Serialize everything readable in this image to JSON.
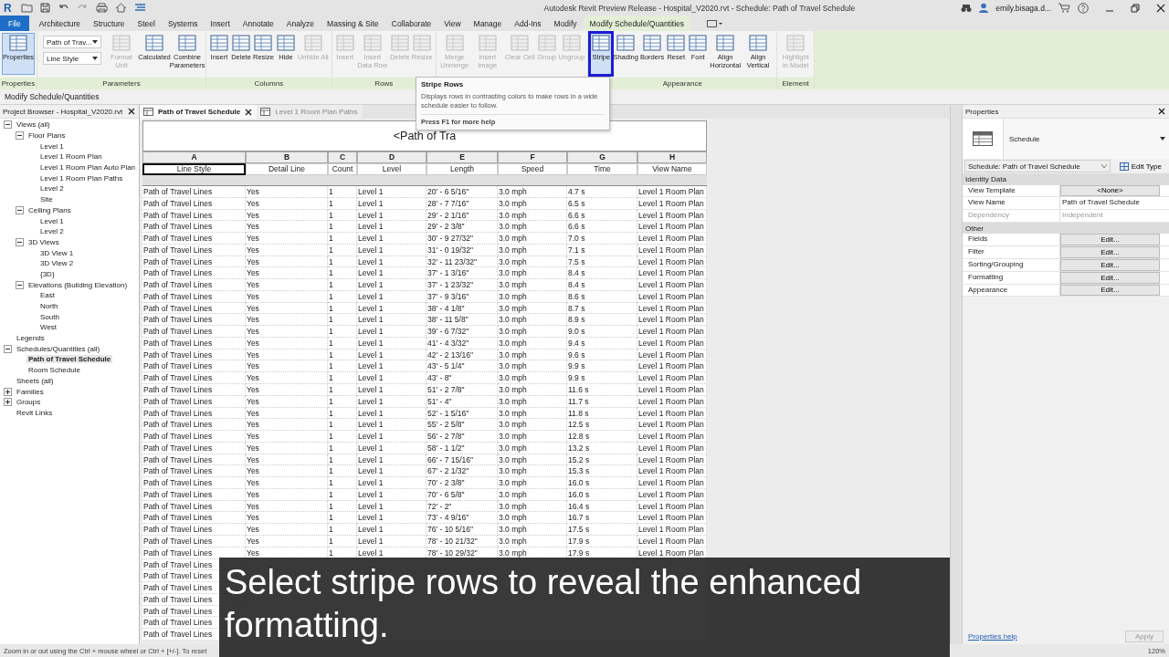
{
  "window": {
    "app_logo": "R",
    "title": "Autodesk Revit Preview Release - Hospital_V2020.rvt - Schedule: Path of Travel Schedule",
    "user": "emily.bisaga.d..."
  },
  "tabs": [
    {
      "label": "File",
      "kind": "file",
      "selected": false
    },
    {
      "label": "Architecture",
      "kind": "tab",
      "selected": false
    },
    {
      "label": "Structure",
      "kind": "tab",
      "selected": false
    },
    {
      "label": "Steel",
      "kind": "tab",
      "selected": false
    },
    {
      "label": "Systems",
      "kind": "tab",
      "selected": false
    },
    {
      "label": "Insert",
      "kind": "tab",
      "selected": false
    },
    {
      "label": "Annotate",
      "kind": "tab",
      "selected": false
    },
    {
      "label": "Analyze",
      "kind": "tab",
      "selected": false
    },
    {
      "label": "Massing & Site",
      "kind": "tab",
      "selected": false
    },
    {
      "label": "Collaborate",
      "kind": "tab",
      "selected": false
    },
    {
      "label": "View",
      "kind": "tab",
      "selected": false
    },
    {
      "label": "Manage",
      "kind": "tab",
      "selected": false
    },
    {
      "label": "Add-Ins",
      "kind": "tab",
      "selected": false
    },
    {
      "label": "Modify",
      "kind": "tab",
      "selected": false
    },
    {
      "label": "Modify Schedule/Quantities",
      "kind": "contextual",
      "selected": true
    }
  ],
  "ribbon": {
    "groups": [
      {
        "label": "Properties",
        "items": [
          {
            "kind": "large",
            "label": "Properties",
            "disabled": false,
            "selected": true
          }
        ]
      },
      {
        "label": "Parameters",
        "items": [
          {
            "kind": "dropdowns",
            "values": [
              "Path of Trav...",
              "Line Style"
            ]
          },
          {
            "kind": "large",
            "label": "Format Unit",
            "disabled": true,
            "selected": false
          },
          {
            "kind": "large",
            "label": "Calculated",
            "disabled": false,
            "selected": false
          },
          {
            "kind": "large",
            "label": "Combine Parameters",
            "disabled": false,
            "selected": false
          }
        ]
      },
      {
        "label": "Columns",
        "items": [
          {
            "kind": "large",
            "label": "Insert",
            "disabled": false,
            "selected": false
          },
          {
            "kind": "large",
            "label": "Delete",
            "disabled": false,
            "selected": false
          },
          {
            "kind": "large",
            "label": "Resize",
            "disabled": false,
            "selected": false
          },
          {
            "kind": "large",
            "label": "Hide",
            "disabled": false,
            "selected": false
          },
          {
            "kind": "large",
            "label": "Unhide All",
            "disabled": true,
            "selected": false
          }
        ]
      },
      {
        "label": "Rows",
        "items": [
          {
            "kind": "large",
            "label": "Insert",
            "disabled": true,
            "selected": false
          },
          {
            "kind": "large",
            "label": "Insert Data Row",
            "disabled": true,
            "selected": false
          },
          {
            "kind": "large",
            "label": "Delete",
            "disabled": true,
            "selected": false
          },
          {
            "kind": "large",
            "label": "Resize",
            "disabled": true,
            "selected": false
          }
        ]
      },
      {
        "items": [
          {
            "kind": "large",
            "label": "Merge Unmerge",
            "disabled": true,
            "selected": false
          },
          {
            "kind": "large",
            "label": "Insert Image",
            "disabled": true,
            "selected": false
          },
          {
            "kind": "large",
            "label": "Clear Cell",
            "disabled": true,
            "selected": false
          },
          {
            "kind": "large",
            "label": "Group",
            "disabled": true,
            "selected": false
          },
          {
            "kind": "large",
            "label": "Ungroup",
            "disabled": true,
            "selected": false
          }
        ]
      },
      {
        "label": "Appearance",
        "items": [
          {
            "kind": "large",
            "label": "Stripe",
            "disabled": false,
            "selected": true,
            "highlighted": true
          },
          {
            "kind": "large",
            "label": "Shading",
            "disabled": false,
            "selected": false
          },
          {
            "kind": "large",
            "label": "Borders",
            "disabled": false,
            "selected": false
          },
          {
            "kind": "large",
            "label": "Reset",
            "disabled": false,
            "selected": false
          },
          {
            "kind": "large",
            "label": "Font",
            "disabled": false,
            "selected": false
          },
          {
            "kind": "large",
            "label": "Align Horizontal",
            "disabled": false,
            "selected": false
          },
          {
            "kind": "large",
            "label": "Align Vertical",
            "disabled": false,
            "selected": false
          }
        ]
      },
      {
        "label": "Element",
        "items": [
          {
            "kind": "large",
            "label": "Highlight in Model",
            "disabled": true,
            "selected": false
          }
        ]
      }
    ]
  },
  "tooltip": {
    "title": "Stripe Rows",
    "text": "Displays rows in contrasting colors to make rows in a wide schedule easier to follow.",
    "help": "Press F1 for more help"
  },
  "options_bar": "Modify Schedule/Quantities",
  "project_browser": {
    "title": "Project Browser - Hospital_V2020.rvt",
    "tree": [
      {
        "label": "Views (all)",
        "expanded": true,
        "selected": false,
        "children": [
          {
            "label": "Floor Plans",
            "expanded": true,
            "selected": false,
            "children": [
              {
                "label": "Level 1",
                "selected": false
              },
              {
                "label": "Level 1 Room Plan",
                "selected": false
              },
              {
                "label": "Level 1 Room Plan Auto Plan",
                "selected": false
              },
              {
                "label": "Level 1 Room Plan Paths",
                "selected": false
              },
              {
                "label": "Level 2",
                "selected": false
              },
              {
                "label": "Site",
                "selected": false
              }
            ]
          },
          {
            "label": "Ceiling Plans",
            "expanded": true,
            "selected": false,
            "children": [
              {
                "label": "Level 1",
                "selected": false
              },
              {
                "label": "Level 2",
                "selected": false
              }
            ]
          },
          {
            "label": "3D Views",
            "expanded": true,
            "selected": false,
            "children": [
              {
                "label": "3D View 1",
                "selected": false
              },
              {
                "label": "3D View 2",
                "selected": false
              },
              {
                "label": "{3D}",
                "selected": false
              }
            ]
          },
          {
            "label": "Elevations (Building Elevation)",
            "expanded": true,
            "selected": false,
            "children": [
              {
                "label": "East",
                "selected": false
              },
              {
                "label": "North",
                "selected": false
              },
              {
                "label": "South",
                "selected": false
              },
              {
                "label": "West",
                "selected": false
              }
            ]
          }
        ]
      },
      {
        "label": "Legends",
        "selected": false
      },
      {
        "label": "Schedules/Quantities (all)",
        "expanded": true,
        "selected": false,
        "children": [
          {
            "label": "Path of Travel Schedule",
            "selected": true
          },
          {
            "label": "Room Schedule",
            "selected": false
          }
        ]
      },
      {
        "label": "Sheets (all)",
        "selected": false
      },
      {
        "label": "Families",
        "expanded": false,
        "selected": false
      },
      {
        "label": "Groups",
        "expanded": false,
        "selected": false
      },
      {
        "label": "Revit Links",
        "selected": false
      }
    ]
  },
  "view_tabs": [
    {
      "label": "Path of Travel Schedule",
      "selected": true
    },
    {
      "label": "Level 1 Room Plan Paths",
      "selected": false
    }
  ],
  "schedule": {
    "title": "<Path of Tra",
    "columns": [
      {
        "letter": "A",
        "name": "Line Style",
        "selected": true
      },
      {
        "letter": "B",
        "name": "Detail Line",
        "selected": false
      },
      {
        "letter": "C",
        "name": "Count",
        "selected": false
      },
      {
        "letter": "D",
        "name": "Level",
        "selected": false
      },
      {
        "letter": "E",
        "name": "Length",
        "selected": false
      },
      {
        "letter": "F",
        "name": "Speed",
        "selected": false
      },
      {
        "letter": "G",
        "name": "Time",
        "selected": false
      },
      {
        "letter": "H",
        "name": "View Name",
        "selected": false
      }
    ],
    "rows": [
      [
        "Path of Travel Lines",
        "Yes",
        "1",
        "Level 1",
        "20' - 6 5/16\"",
        "3.0 mph",
        "4.7 s",
        "Level 1 Room Plan"
      ],
      [
        "Path of Travel Lines",
        "Yes",
        "1",
        "Level 1",
        "28' - 7 7/16\"",
        "3.0 mph",
        "6.5 s",
        "Level 1 Room Plan"
      ],
      [
        "Path of Travel Lines",
        "Yes",
        "1",
        "Level 1",
        "29' - 2 1/16\"",
        "3.0 mph",
        "6.6 s",
        "Level 1 Room Plan"
      ],
      [
        "Path of Travel Lines",
        "Yes",
        "1",
        "Level 1",
        "29' - 2 3/8\"",
        "3.0 mph",
        "6.6 s",
        "Level 1 Room Plan"
      ],
      [
        "Path of Travel Lines",
        "Yes",
        "1",
        "Level 1",
        "30' - 9 27/32\"",
        "3.0 mph",
        "7.0 s",
        "Level 1 Room Plan"
      ],
      [
        "Path of Travel Lines",
        "Yes",
        "1",
        "Level 1",
        "31' - 0 19/32\"",
        "3.0 mph",
        "7.1 s",
        "Level 1 Room Plan"
      ],
      [
        "Path of Travel Lines",
        "Yes",
        "1",
        "Level 1",
        "32' - 11 23/32\"",
        "3.0 mph",
        "7.5 s",
        "Level 1 Room Plan"
      ],
      [
        "Path of Travel Lines",
        "Yes",
        "1",
        "Level 1",
        "37' - 1 3/16\"",
        "3.0 mph",
        "8.4 s",
        "Level 1 Room Plan"
      ],
      [
        "Path of Travel Lines",
        "Yes",
        "1",
        "Level 1",
        "37' - 1 23/32\"",
        "3.0 mph",
        "8.4 s",
        "Level 1 Room Plan"
      ],
      [
        "Path of Travel Lines",
        "Yes",
        "1",
        "Level 1",
        "37' - 9 3/16\"",
        "3.0 mph",
        "8.6 s",
        "Level 1 Room Plan"
      ],
      [
        "Path of Travel Lines",
        "Yes",
        "1",
        "Level 1",
        "38' - 4 1/8\"",
        "3.0 mph",
        "8.7 s",
        "Level 1 Room Plan"
      ],
      [
        "Path of Travel Lines",
        "Yes",
        "1",
        "Level 1",
        "38' - 11 5/8\"",
        "3.0 mph",
        "8.9 s",
        "Level 1 Room Plan"
      ],
      [
        "Path of Travel Lines",
        "Yes",
        "1",
        "Level 1",
        "39' - 6 7/32\"",
        "3.0 mph",
        "9.0 s",
        "Level 1 Room Plan"
      ],
      [
        "Path of Travel Lines",
        "Yes",
        "1",
        "Level 1",
        "41' - 4 3/32\"",
        "3.0 mph",
        "9.4 s",
        "Level 1 Room Plan"
      ],
      [
        "Path of Travel Lines",
        "Yes",
        "1",
        "Level 1",
        "42' - 2 13/16\"",
        "3.0 mph",
        "9.6 s",
        "Level 1 Room Plan"
      ],
      [
        "Path of Travel Lines",
        "Yes",
        "1",
        "Level 1",
        "43' - 5 1/4\"",
        "3.0 mph",
        "9.9 s",
        "Level 1 Room Plan"
      ],
      [
        "Path of Travel Lines",
        "Yes",
        "1",
        "Level 1",
        "43' - 8\"",
        "3.0 mph",
        "9.9 s",
        "Level 1 Room Plan"
      ],
      [
        "Path of Travel Lines",
        "Yes",
        "1",
        "Level 1",
        "51' - 2 7/8\"",
        "3.0 mph",
        "11.6 s",
        "Level 1 Room Plan"
      ],
      [
        "Path of Travel Lines",
        "Yes",
        "1",
        "Level 1",
        "51' - 4\"",
        "3.0 mph",
        "11.7 s",
        "Level 1 Room Plan"
      ],
      [
        "Path of Travel Lines",
        "Yes",
        "1",
        "Level 1",
        "52' - 1 5/16\"",
        "3.0 mph",
        "11.8 s",
        "Level 1 Room Plan"
      ],
      [
        "Path of Travel Lines",
        "Yes",
        "1",
        "Level 1",
        "55' - 2 5/8\"",
        "3.0 mph",
        "12.5 s",
        "Level 1 Room Plan"
      ],
      [
        "Path of Travel Lines",
        "Yes",
        "1",
        "Level 1",
        "56' - 2 7/8\"",
        "3.0 mph",
        "12.8 s",
        "Level 1 Room Plan"
      ],
      [
        "Path of Travel Lines",
        "Yes",
        "1",
        "Level 1",
        "58' - 1 1/2\"",
        "3.0 mph",
        "13.2 s",
        "Level 1 Room Plan"
      ],
      [
        "Path of Travel Lines",
        "Yes",
        "1",
        "Level 1",
        "66' - 7 15/16\"",
        "3.0 mph",
        "15.2 s",
        "Level 1 Room Plan"
      ],
      [
        "Path of Travel Lines",
        "Yes",
        "1",
        "Level 1",
        "67' - 2 1/32\"",
        "3.0 mph",
        "15.3 s",
        "Level 1 Room Plan"
      ],
      [
        "Path of Travel Lines",
        "Yes",
        "1",
        "Level 1",
        "70' - 2 3/8\"",
        "3.0 mph",
        "16.0 s",
        "Level 1 Room Plan"
      ],
      [
        "Path of Travel Lines",
        "Yes",
        "1",
        "Level 1",
        "70' - 6 5/8\"",
        "3.0 mph",
        "16.0 s",
        "Level 1 Room Plan"
      ],
      [
        "Path of Travel Lines",
        "Yes",
        "1",
        "Level 1",
        "72' - 2\"",
        "3.0 mph",
        "16.4 s",
        "Level 1 Room Plan"
      ],
      [
        "Path of Travel Lines",
        "Yes",
        "1",
        "Level 1",
        "73' - 4 9/16\"",
        "3.0 mph",
        "16.7 s",
        "Level 1 Room Plan"
      ],
      [
        "Path of Travel Lines",
        "Yes",
        "1",
        "Level 1",
        "76' - 10 5/16\"",
        "3.0 mph",
        "17.5 s",
        "Level 1 Room Plan"
      ],
      [
        "Path of Travel Lines",
        "Yes",
        "1",
        "Level 1",
        "78' - 10 21/32\"",
        "3.0 mph",
        "17.9 s",
        "Level 1 Room Plan"
      ],
      [
        "Path of Travel Lines",
        "Yes",
        "1",
        "Level 1",
        "78' - 10 29/32\"",
        "3.0 mph",
        "17.9 s",
        "Level 1 Room Plan"
      ],
      [
        "Path of Travel Lines"
      ],
      [
        "Path of Travel Lines"
      ],
      [
        "Path of Travel Lines"
      ],
      [
        "Path of Travel Lines"
      ],
      [
        "Path of Travel Lines"
      ],
      [
        "Path of Travel Lines"
      ],
      [
        "Path of Travel Lines"
      ]
    ]
  },
  "properties": {
    "title": "Properties",
    "type": "Schedule",
    "selector": "Schedule: Path of Travel Schedule",
    "edit_type": "Edit Type",
    "sections": [
      {
        "title": "Identity Data",
        "rows": [
          {
            "label": "View Template",
            "value": "<None>",
            "kind": "button",
            "disabled": false
          },
          {
            "label": "View Name",
            "value": "Path of Travel Schedule",
            "kind": "text",
            "disabled": false
          },
          {
            "label": "Dependency",
            "value": "Independent",
            "kind": "text",
            "disabled": true
          }
        ]
      },
      {
        "title": "Other",
        "rows": [
          {
            "label": "Fields",
            "value": "Edit...",
            "kind": "button",
            "disabled": false
          },
          {
            "label": "Filter",
            "value": "Edit...",
            "kind": "button",
            "disabled": false
          },
          {
            "label": "Sorting/Grouping",
            "value": "Edit...",
            "kind": "button",
            "disabled": false
          },
          {
            "label": "Formatting",
            "value": "Edit...",
            "kind": "button",
            "disabled": false
          },
          {
            "label": "Appearance",
            "value": "Edit...",
            "kind": "button",
            "disabled": false
          }
        ]
      }
    ],
    "help_link": "Properties help",
    "apply": "Apply"
  },
  "status_bar": {
    "text": "Zoom in or out using the Ctrl + mouse wheel or Ctrl + [+/-]. To reset",
    "zoom": "120%"
  },
  "caption": "Select stripe rows to reveal the enhanced formatting."
}
